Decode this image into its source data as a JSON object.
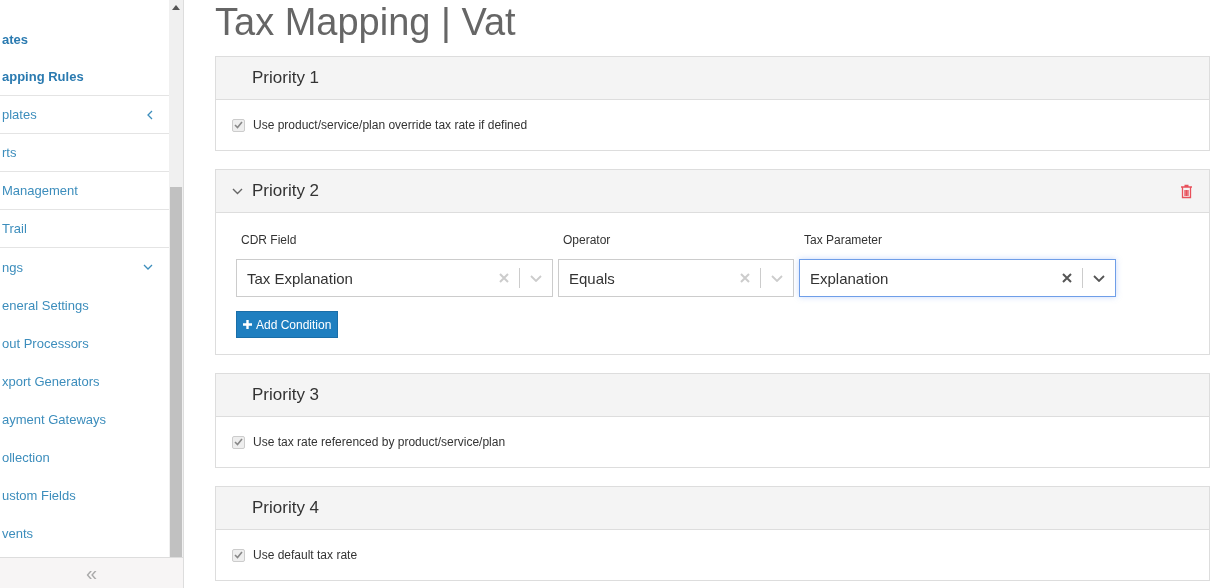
{
  "sidebar": {
    "items": [
      {
        "label": "ates",
        "bold": true,
        "divider": false
      },
      {
        "label": "apping Rules",
        "bold": true,
        "divider": true
      },
      {
        "label": "plates",
        "bold": false,
        "divider": true,
        "expanded": false
      },
      {
        "label": "rts",
        "bold": false,
        "divider": true
      },
      {
        "label": "Management",
        "bold": false,
        "divider": true
      },
      {
        "label": "Trail",
        "bold": false,
        "divider": true
      },
      {
        "label": "ngs",
        "bold": false,
        "divider": false,
        "expanded": true
      },
      {
        "label": "eneral Settings",
        "bold": false,
        "divider": false
      },
      {
        "label": "out Processors",
        "bold": false,
        "divider": false
      },
      {
        "label": "xport Generators",
        "bold": false,
        "divider": false
      },
      {
        "label": "ayment Gateways",
        "bold": false,
        "divider": false
      },
      {
        "label": "ollection",
        "bold": false,
        "divider": false
      },
      {
        "label": "ustom Fields",
        "bold": false,
        "divider": false
      },
      {
        "label": "vents",
        "bold": false,
        "divider": false
      }
    ],
    "collapse": "«"
  },
  "page": {
    "title": "Tax Mapping | Vat"
  },
  "priorities": [
    {
      "title": "Priority 1",
      "kind": "checkbox",
      "expanded": false,
      "deletable": false,
      "label": "Use product/service/plan override tax rate if defined",
      "checked": true
    },
    {
      "title": "Priority 2",
      "kind": "conditions",
      "expanded": true,
      "deletable": true,
      "fields": [
        {
          "label": "CDR Field",
          "value": "Tax Explanation",
          "focused": false
        },
        {
          "label": "Operator",
          "value": "Equals",
          "focused": false
        },
        {
          "label": "Tax Parameter",
          "value": "Explanation",
          "focused": true
        }
      ],
      "button": "Add Condition"
    },
    {
      "title": "Priority 3",
      "kind": "checkbox",
      "expanded": false,
      "deletable": false,
      "label": "Use tax rate referenced by product/service/plan",
      "checked": true
    },
    {
      "title": "Priority 4",
      "kind": "checkbox",
      "expanded": false,
      "deletable": false,
      "label": "Use default tax rate",
      "checked": true
    }
  ]
}
